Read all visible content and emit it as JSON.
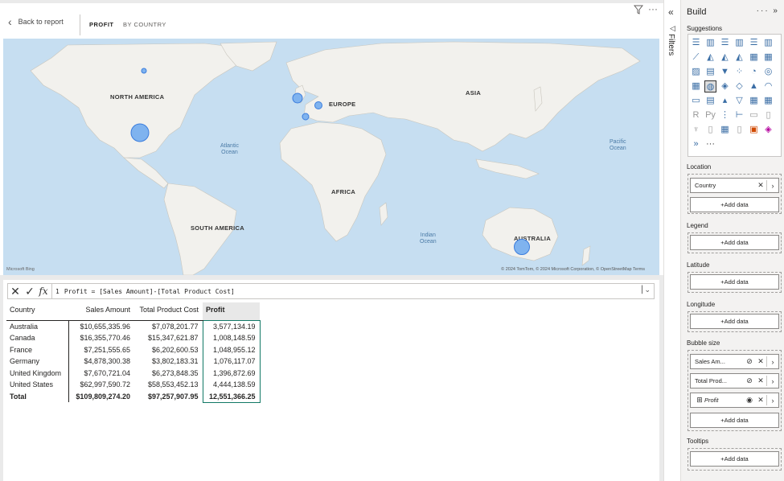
{
  "report": {
    "back_label": "Back to report",
    "tabs": [
      "PROFIT",
      "BY COUNTRY"
    ],
    "more_options": "···"
  },
  "map": {
    "continents": [
      "NORTH AMERICA",
      "EUROPE",
      "ASIA",
      "AFRICA",
      "SOUTH AMERICA",
      "AUSTRALIA"
    ],
    "oceans": [
      "Atlantic\nOcean",
      "Pacific\nOcean",
      "Indian\nOcean"
    ],
    "attribution": "Microsoft Bing",
    "copyright": "© 2024 TomTom, © 2024 Microsoft Corporation, © OpenStreetMap  Terms",
    "bubble_color": "#7fb3ef"
  },
  "formula_bar": {
    "line": "1",
    "text_prefix": "Profit = ",
    "ref1": "[Sales Amount]",
    "op": "-",
    "ref2": "[Total Product Cost]"
  },
  "matrix": {
    "headers": [
      "Country",
      "Sales Amount",
      "Total Product Cost",
      "Profit"
    ],
    "rows": [
      [
        "Australia",
        "$10,655,335.96",
        "$7,078,201.77",
        "3,577,134.19"
      ],
      [
        "Canada",
        "$16,355,770.46",
        "$15,347,621.87",
        "1,008,148.59"
      ],
      [
        "France",
        "$7,251,555.65",
        "$6,202,600.53",
        "1,048,955.12"
      ],
      [
        "Germany",
        "$4,878,300.38",
        "$3,802,183.31",
        "1,076,117.07"
      ],
      [
        "United Kingdom",
        "$7,670,721.04",
        "$6,273,848.35",
        "1,396,872.69"
      ],
      [
        "United States",
        "$62,997,590.72",
        "$58,553,452.13",
        "4,444,138.59"
      ]
    ],
    "total": [
      "Total",
      "$109,809,274.20",
      "$97,257,907.95",
      "12,551,366.25"
    ],
    "selection_color": "#117865"
  },
  "filters": {
    "label": "Filters"
  },
  "build": {
    "title": "Build",
    "tools": "··· »",
    "suggestions": "Suggestions",
    "sections": {
      "location": "Location",
      "legend": "Legend",
      "latitude": "Latitude",
      "longitude": "Longitude",
      "bubble_size": "Bubble size",
      "tooltips": "Tooltips"
    },
    "location_field": "Country",
    "bubble_fields": [
      "Sales Am...",
      "Total Prod...",
      "Profit"
    ],
    "add_data": "+Add data"
  }
}
